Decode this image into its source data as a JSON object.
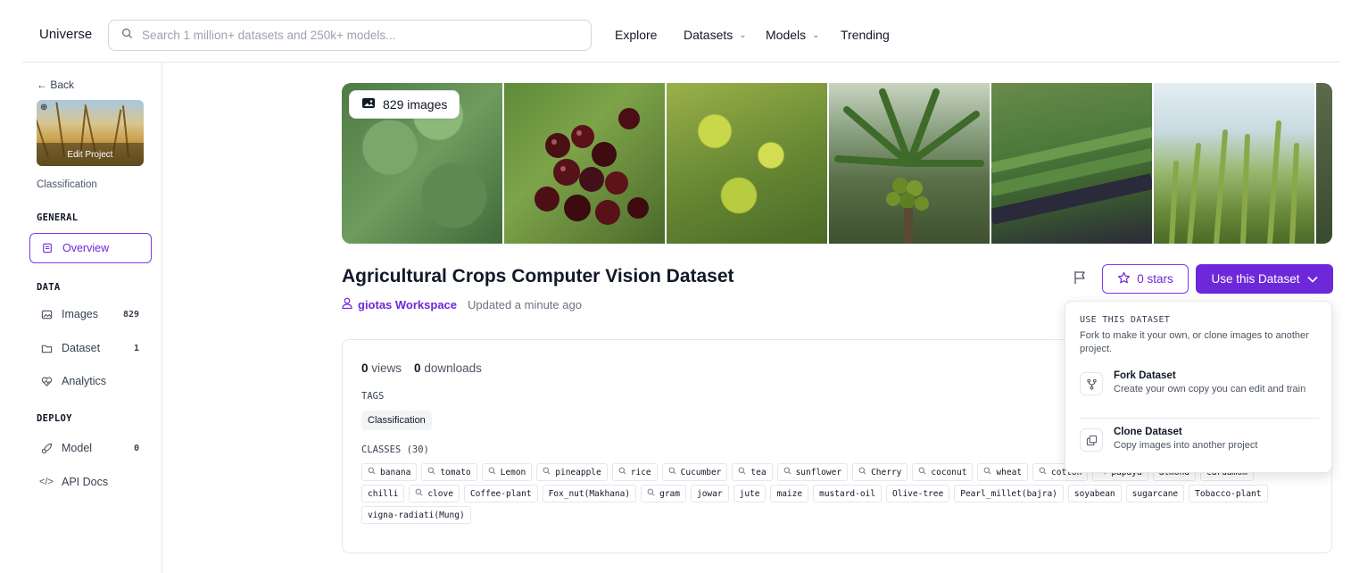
{
  "header": {
    "brand": "Universe",
    "search_placeholder": "Search 1 million+ datasets and 250k+ models...",
    "nav": [
      {
        "label": "Explore",
        "dropdown": false
      },
      {
        "label": "Datasets",
        "dropdown": true
      },
      {
        "label": "Models",
        "dropdown": true
      },
      {
        "label": "Trending",
        "dropdown": false
      }
    ]
  },
  "sidebar": {
    "back_label": "Back",
    "edit_project_label": "Edit Project",
    "project_type": "Classification",
    "sections": {
      "general": "GENERAL",
      "data": "DATA",
      "deploy": "DEPLOY"
    },
    "items": {
      "overview": {
        "label": "Overview"
      },
      "images": {
        "label": "Images",
        "count": "829"
      },
      "dataset": {
        "label": "Dataset",
        "count": "1"
      },
      "analytics": {
        "label": "Analytics"
      },
      "model": {
        "label": "Model",
        "count": "0"
      },
      "api_docs": {
        "label": "API Docs"
      }
    }
  },
  "main": {
    "image_count_label": "829 images",
    "title": "Agricultural Crops Computer Vision Dataset",
    "workspace": "giotas Workspace",
    "updated": "Updated a minute ago",
    "stars_label": "0 stars",
    "use_dataset_label": "Use this Dataset",
    "views_count": "0",
    "views_label": "views",
    "downloads_count": "0",
    "downloads_label": "downloads",
    "tags_label": "TAGS",
    "tags": [
      "Classification"
    ],
    "classes_label": "CLASSES (30)",
    "classes": [
      {
        "name": "banana",
        "searchable": true
      },
      {
        "name": "tomato",
        "searchable": true
      },
      {
        "name": "Lemon",
        "searchable": true
      },
      {
        "name": "pineapple",
        "searchable": true
      },
      {
        "name": "rice",
        "searchable": true
      },
      {
        "name": "Cucumber",
        "searchable": true
      },
      {
        "name": "tea",
        "searchable": true
      },
      {
        "name": "sunflower",
        "searchable": true
      },
      {
        "name": "Cherry",
        "searchable": true
      },
      {
        "name": "coconut",
        "searchable": true
      },
      {
        "name": "wheat",
        "searchable": true
      },
      {
        "name": "cotton",
        "searchable": true
      },
      {
        "name": "papaya",
        "searchable": true
      },
      {
        "name": "almond",
        "searchable": false
      },
      {
        "name": "cardamom",
        "searchable": false
      },
      {
        "name": "chilli",
        "searchable": false
      },
      {
        "name": "clove",
        "searchable": true
      },
      {
        "name": "Coffee-plant",
        "searchable": false
      },
      {
        "name": "Fox_nut(Makhana)",
        "searchable": false
      },
      {
        "name": "gram",
        "searchable": true
      },
      {
        "name": "jowar",
        "searchable": false
      },
      {
        "name": "jute",
        "searchable": false
      },
      {
        "name": "maize",
        "searchable": false
      },
      {
        "name": "mustard-oil",
        "searchable": false
      },
      {
        "name": "Olive-tree",
        "searchable": false
      },
      {
        "name": "Pearl_millet(bajra)",
        "searchable": false
      },
      {
        "name": "soyabean",
        "searchable": false
      },
      {
        "name": "sugarcane",
        "searchable": false
      },
      {
        "name": "Tobacco-plant",
        "searchable": false
      },
      {
        "name": "vigna-radiati(Mung)",
        "searchable": false
      }
    ]
  },
  "dropdown": {
    "heading": "USE THIS DATASET",
    "subtitle": "Fork to make it your own, or clone images to another project.",
    "fork_title": "Fork Dataset",
    "fork_desc": "Create your own copy you can edit and train",
    "clone_title": "Clone Dataset",
    "clone_desc": "Copy images into another project"
  },
  "colors": {
    "accent": "#6d28d9",
    "border": "#e5e7eb",
    "muted_text": "#6b7280"
  },
  "icons": [
    "search-icon",
    "chevron-down-icon",
    "back-arrow-icon",
    "globe-icon",
    "document-icon",
    "image-icon",
    "folder-icon",
    "analytics-icon",
    "rocket-icon",
    "code-icon",
    "images-icon",
    "user-icon",
    "flag-icon",
    "star-icon",
    "fork-icon",
    "copy-icon"
  ]
}
